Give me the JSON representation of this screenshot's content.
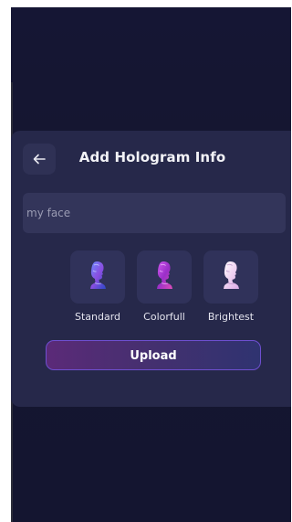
{
  "dialog": {
    "title": "Add Hologram Info",
    "back_icon": "arrow-left-icon",
    "name_field": {
      "value": "",
      "placeholder": "my face"
    },
    "styles": [
      {
        "label": "Standard",
        "icon": "bust-statue-icon",
        "color": "#4a6fe0"
      },
      {
        "label": "Colorfull",
        "icon": "bust-statue-icon",
        "color": "#b13bd6"
      },
      {
        "label": "Brightest",
        "icon": "bust-statue-icon",
        "color": "#e8c9ec"
      }
    ],
    "upload_label": "Upload"
  },
  "colors": {
    "background": "#151634",
    "panel": "#26284a",
    "field": "#33355a",
    "tile": "#30325a",
    "upload_gradient_start": "#5b2a78",
    "upload_gradient_end": "#2f3370",
    "upload_border": "#6e4fd0"
  }
}
